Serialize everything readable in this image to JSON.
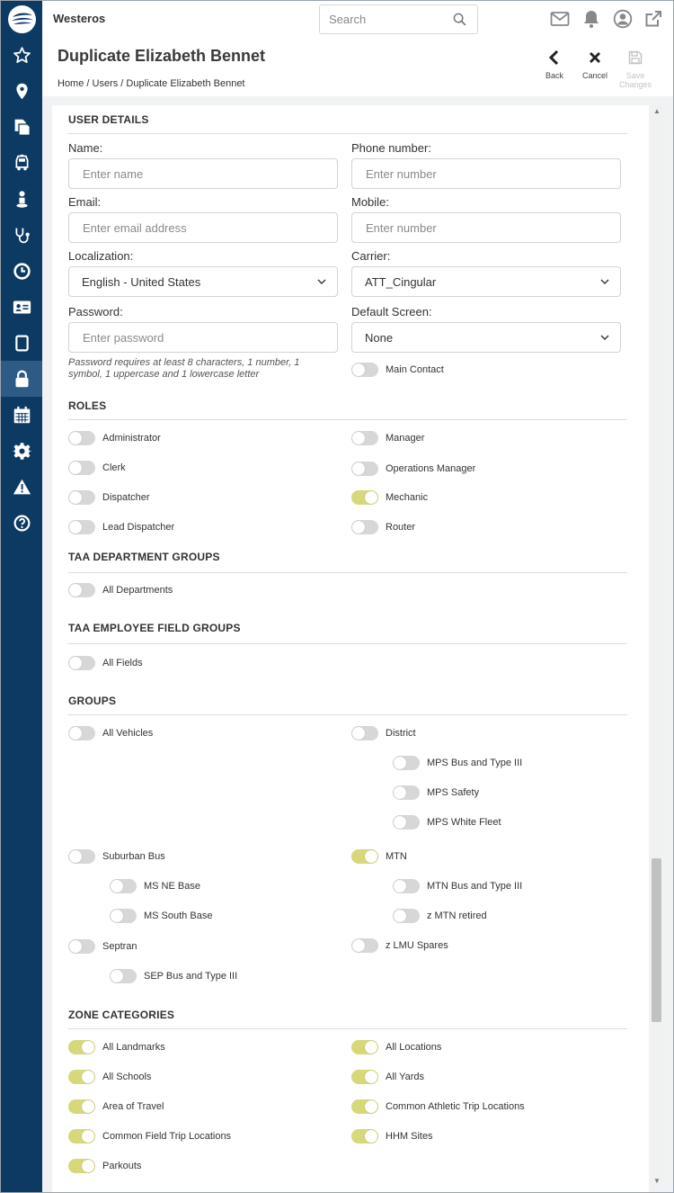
{
  "app": {
    "brand": "Westeros"
  },
  "search": {
    "placeholder": "Search"
  },
  "page": {
    "title": "Duplicate Elizabeth Bennet",
    "breadcrumb": "Home / Users / Duplicate Elizabeth Bennet"
  },
  "actions": {
    "back": "Back",
    "cancel": "Cancel",
    "save_line1": "Save",
    "save_line2": "Changes"
  },
  "sidebar": {
    "logo": "company-logo",
    "items": [
      {
        "icon": "star-icon"
      },
      {
        "icon": "map-pin-icon"
      },
      {
        "icon": "documents-icon"
      },
      {
        "icon": "bus-icon"
      },
      {
        "icon": "person-icon"
      },
      {
        "icon": "stethoscope-icon"
      },
      {
        "icon": "clock-icon"
      },
      {
        "icon": "id-card-icon"
      },
      {
        "icon": "tablet-icon"
      },
      {
        "icon": "lock-icon",
        "active": true
      },
      {
        "icon": "calendar-icon"
      },
      {
        "icon": "gear-icon"
      },
      {
        "icon": "warning-icon"
      },
      {
        "icon": "help-icon"
      }
    ]
  },
  "user_details": {
    "title": "USER DETAILS",
    "name": {
      "label": "Name:",
      "placeholder": "Enter name",
      "value": ""
    },
    "phone": {
      "label": "Phone number:",
      "placeholder": "Enter number",
      "value": ""
    },
    "email": {
      "label": "Email:",
      "placeholder": "Enter email address",
      "value": ""
    },
    "mobile": {
      "label": "Mobile:",
      "placeholder": "Enter number",
      "value": ""
    },
    "localization": {
      "label": "Localization:",
      "value": "English - United States"
    },
    "carrier": {
      "label": "Carrier:",
      "value": "ATT_Cingular"
    },
    "password": {
      "label": "Password:",
      "placeholder": "Enter password",
      "value": ""
    },
    "password_hint": "Password requires at least 8 characters, 1 number, 1 symbol, 1 uppercase and 1 lowercase letter",
    "default_screen": {
      "label": "Default Screen:",
      "value": "None"
    },
    "main_contact": {
      "label": "Main Contact",
      "on": false
    }
  },
  "roles": {
    "title": "ROLES",
    "items": [
      {
        "label": "Administrator",
        "on": false
      },
      {
        "label": "Manager",
        "on": false
      },
      {
        "label": "Clerk",
        "on": false
      },
      {
        "label": "Operations Manager",
        "on": false
      },
      {
        "label": "Dispatcher",
        "on": false
      },
      {
        "label": "Mechanic",
        "on": true
      },
      {
        "label": "Lead Dispatcher",
        "on": false
      },
      {
        "label": "Router",
        "on": false
      }
    ]
  },
  "taa_department_groups": {
    "title": "TAA DEPARTMENT GROUPS",
    "items": [
      {
        "label": "All Departments",
        "on": false
      }
    ]
  },
  "taa_employee_field_groups": {
    "title": "TAA EMPLOYEE FIELD GROUPS",
    "items": [
      {
        "label": "All Fields",
        "on": false
      }
    ]
  },
  "groups": {
    "title": "GROUPS",
    "items": [
      {
        "label": "All Vehicles",
        "on": false
      },
      {
        "label": "District",
        "on": false
      },
      {
        "label": "MPS Bus and Type III",
        "on": false
      },
      {
        "label": "MPS Safety",
        "on": false
      },
      {
        "label": "MPS White Fleet",
        "on": false
      },
      {
        "label": "Suburban Bus",
        "on": false
      },
      {
        "label": "MTN",
        "on": true
      },
      {
        "label": "MS NE Base",
        "on": false
      },
      {
        "label": "MTN Bus and Type III",
        "on": false
      },
      {
        "label": "MS South Base",
        "on": false
      },
      {
        "label": "z MTN retired",
        "on": false
      },
      {
        "label": "Septran",
        "on": false
      },
      {
        "label": "z LMU Spares",
        "on": false
      },
      {
        "label": "SEP Bus and Type III",
        "on": false
      }
    ]
  },
  "zone_categories": {
    "title": "ZONE CATEGORIES",
    "items": [
      {
        "label": "All Landmarks",
        "on": true
      },
      {
        "label": "All Locations",
        "on": true
      },
      {
        "label": "All Schools",
        "on": true
      },
      {
        "label": "All Yards",
        "on": true
      },
      {
        "label": "Area of Travel",
        "on": true
      },
      {
        "label": "Common Athletic Trip Locations",
        "on": true
      },
      {
        "label": "Common Field Trip Locations",
        "on": true
      },
      {
        "label": "HHM Sites",
        "on": true
      },
      {
        "label": "Parkouts",
        "on": true
      }
    ]
  },
  "colors": {
    "sidebar": "#0d3a63",
    "sidebar_active": "#2e5a86",
    "toggle_on": "#d6d87a",
    "toggle_off": "#d7d7d7"
  }
}
